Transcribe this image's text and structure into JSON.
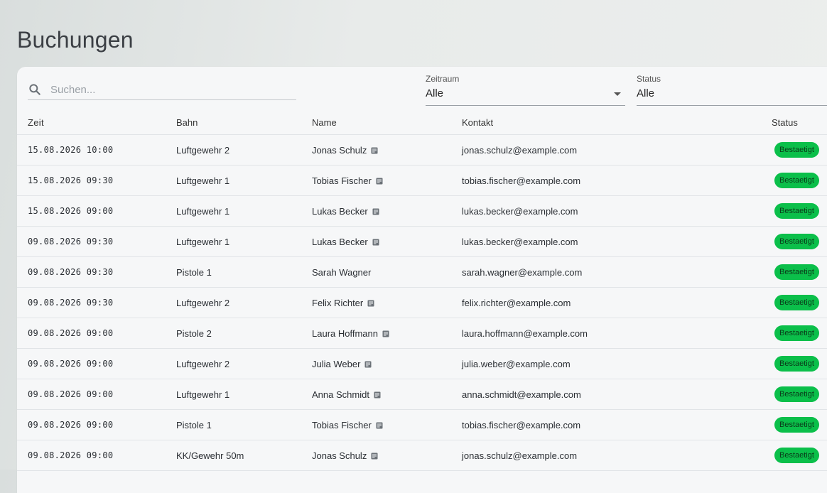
{
  "page": {
    "title": "Buchungen"
  },
  "filters": {
    "search_placeholder": "Suchen...",
    "zeitraum": {
      "label": "Zeitraum",
      "value": "Alle"
    },
    "status": {
      "label": "Status",
      "value": "Alle"
    }
  },
  "table": {
    "headers": {
      "zeit": "Zeit",
      "bahn": "Bahn",
      "name": "Name",
      "kontakt": "Kontakt",
      "status": "Status"
    },
    "rows": [
      {
        "zeit": "15.08.2026 10:00",
        "bahn": "Luftgewehr 2",
        "name": "Jonas Schulz",
        "note": true,
        "kontakt": "jonas.schulz@example.com",
        "status": "Bestaetigt"
      },
      {
        "zeit": "15.08.2026 09:30",
        "bahn": "Luftgewehr 1",
        "name": "Tobias Fischer",
        "note": true,
        "kontakt": "tobias.fischer@example.com",
        "status": "Bestaetigt"
      },
      {
        "zeit": "15.08.2026 09:00",
        "bahn": "Luftgewehr 1",
        "name": "Lukas Becker",
        "note": true,
        "kontakt": "lukas.becker@example.com",
        "status": "Bestaetigt"
      },
      {
        "zeit": "09.08.2026 09:30",
        "bahn": "Luftgewehr 1",
        "name": "Lukas Becker",
        "note": true,
        "kontakt": "lukas.becker@example.com",
        "status": "Bestaetigt"
      },
      {
        "zeit": "09.08.2026 09:30",
        "bahn": "Pistole 1",
        "name": "Sarah Wagner",
        "note": false,
        "kontakt": "sarah.wagner@example.com",
        "status": "Bestaetigt"
      },
      {
        "zeit": "09.08.2026 09:30",
        "bahn": "Luftgewehr 2",
        "name": "Felix Richter",
        "note": true,
        "kontakt": "felix.richter@example.com",
        "status": "Bestaetigt"
      },
      {
        "zeit": "09.08.2026 09:00",
        "bahn": "Pistole 2",
        "name": "Laura Hoffmann",
        "note": true,
        "kontakt": "laura.hoffmann@example.com",
        "status": "Bestaetigt"
      },
      {
        "zeit": "09.08.2026 09:00",
        "bahn": "Luftgewehr 2",
        "name": "Julia Weber",
        "note": true,
        "kontakt": "julia.weber@example.com",
        "status": "Bestaetigt"
      },
      {
        "zeit": "09.08.2026 09:00",
        "bahn": "Luftgewehr 1",
        "name": "Anna Schmidt",
        "note": true,
        "kontakt": "anna.schmidt@example.com",
        "status": "Bestaetigt"
      },
      {
        "zeit": "09.08.2026 09:00",
        "bahn": "Pistole 1",
        "name": "Tobias Fischer",
        "note": true,
        "kontakt": "tobias.fischer@example.com",
        "status": "Bestaetigt"
      },
      {
        "zeit": "09.08.2026 09:00",
        "bahn": "KK/Gewehr 50m",
        "name": "Jonas Schulz",
        "note": true,
        "kontakt": "jonas.schulz@example.com",
        "status": "Bestaetigt"
      }
    ]
  },
  "colors": {
    "status_badge": "#0bbf4a"
  },
  "icons": {
    "search": "search-icon",
    "note": "note-icon",
    "caret": "chevron-down-icon"
  }
}
